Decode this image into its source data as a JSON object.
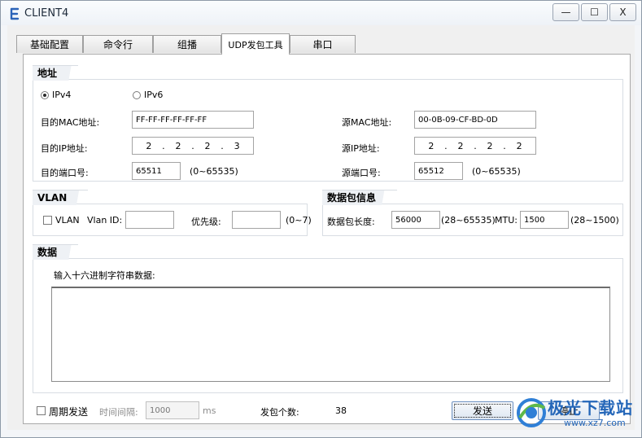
{
  "window": {
    "title": "CLIENT4",
    "buttons": {
      "minimize": "—",
      "maximize": "☐",
      "close": "X"
    }
  },
  "tabs": [
    {
      "label": "基础配置"
    },
    {
      "label": "命令行"
    },
    {
      "label": "组播"
    },
    {
      "label": "UDP发包工具"
    },
    {
      "label": "串口"
    }
  ],
  "address": {
    "title": "地址",
    "ipv4_label": "IPv4",
    "ipv6_label": "IPv6",
    "dest_mac_label": "目的MAC地址:",
    "dest_mac_value": "FF-FF-FF-FF-FF-FF",
    "src_mac_label": "源MAC地址:",
    "src_mac_value": "00-0B-09-CF-BD-0D",
    "dest_ip_label": "目的IP地址:",
    "dest_ip": [
      "2",
      "2",
      "2",
      "3"
    ],
    "src_ip_label": "源IP地址:",
    "src_ip": [
      "2",
      "2",
      "2",
      "2"
    ],
    "dest_port_label": "目的端口号:",
    "dest_port_value": "65511",
    "dest_port_range": "(0~65535)",
    "src_port_label": "源端口号:",
    "src_port_value": "65512",
    "src_port_range": "(0~65535)"
  },
  "vlan": {
    "title": "VLAN",
    "checkbox_label": "VLAN",
    "vlan_id_label": "Vlan ID:",
    "vlan_id_value": "",
    "priority_label": "优先级:",
    "priority_value": "",
    "priority_range": "(0~7)"
  },
  "packet": {
    "title": "数据包信息",
    "length_label": "数据包长度:",
    "length_value": "56000",
    "length_range": "(28~65535)",
    "mtu_label": "MTU:",
    "mtu_value": "1500",
    "mtu_range": "(28~1500)"
  },
  "data": {
    "title": "数据",
    "prompt": "输入十六进制字符串数据:",
    "value": ""
  },
  "footer": {
    "periodic_label": "周期发送",
    "interval_label": "时间间隔:",
    "interval_value": "1000",
    "interval_unit": "ms",
    "count_label": "发包个数:",
    "count_value": "38",
    "send_label": "发送",
    "stop_label": "停止"
  },
  "watermark": {
    "text": "极光下载站",
    "url": "www.xz7.com"
  }
}
